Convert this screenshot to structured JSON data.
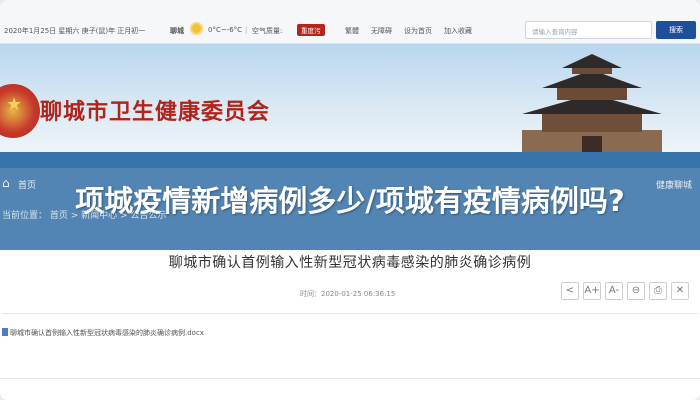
{
  "topbar": {
    "date": "2020年1月25日 星期六 庚子(鼠)年 正月初一",
    "city": "聊城",
    "temperature": "0°C~-6°C",
    "aqi_label": "空气质量:",
    "aqi_value": "重度污",
    "links": [
      "繁體",
      "无障碍",
      "设为首页",
      "加入收藏"
    ],
    "search_placeholder": "请输入查询内容",
    "search_button": "搜索"
  },
  "banner": {
    "site_name": "聊城市卫生健康委员会"
  },
  "overlay": {
    "title": "项城疫情新增病例多少/项城有疫情病例吗?"
  },
  "nav": {
    "left": "首页",
    "right": "健康聊城"
  },
  "breadcrumb": "当前位置： 首页 > 新闻中心 > 公告公示",
  "article": {
    "title": "聊城市确认首例输入性新型冠状病毒感染的肺炎确诊病例",
    "time": "时间：2020-01-25 06:36:15",
    "attachment": "聊城市确认首例输入性新型冠状病毒感染的肺炎确诊病例.docx"
  },
  "tools": [
    "<",
    "A+",
    "A-",
    "⊖",
    "⎙",
    "✕"
  ]
}
